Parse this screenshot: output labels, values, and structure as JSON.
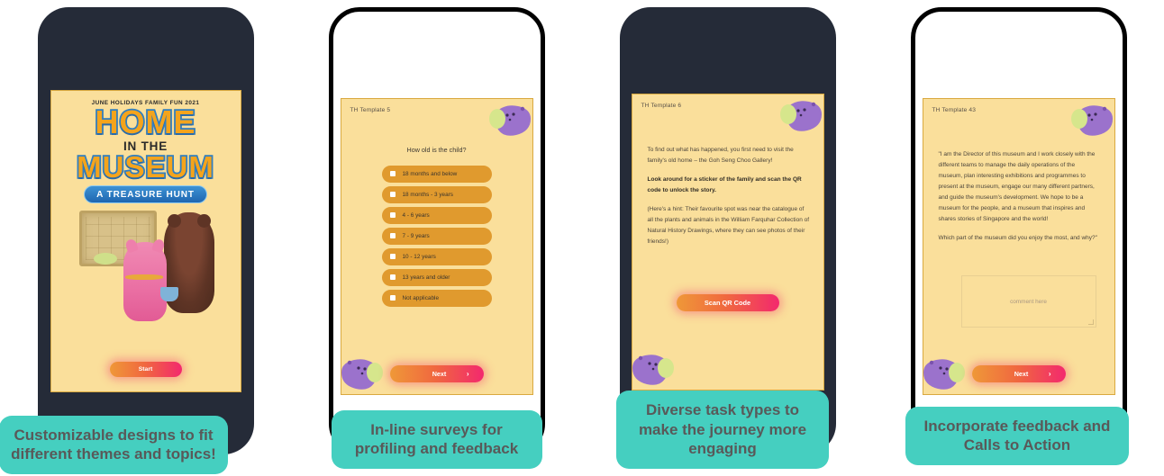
{
  "panels": [
    {
      "frame_style": "solid",
      "caption": "Customizable designs to fit different themes and topics!",
      "cover": {
        "kicker": "JUNE HOLIDAYS FAMILY FUN 2021",
        "title_line1": "HOME",
        "title_line2": "IN THE",
        "title_line3": "MUSEUM",
        "ribbon": "A TREASURE HUNT",
        "cta_label": "Start"
      }
    },
    {
      "frame_style": "outline",
      "caption": "In-line surveys for profiling and feedback",
      "template_label": "TH Template 5",
      "question": "How old is the child?",
      "options": [
        "18 months and below",
        "18 months - 3 years",
        "4 - 6 years",
        "7 - 9 years",
        "10 - 12 years",
        "13 years and older",
        "Not applicable"
      ],
      "cta_label": "Next",
      "cta_chevron": "›"
    },
    {
      "frame_style": "solid",
      "caption": "Diverse task types to make the journey more engaging",
      "template_label": "TH Template 6",
      "paragraphs": [
        {
          "text": "To find out what has happened, you first need to visit the family's old home – the Goh Seng Choo Gallery!",
          "bold": false
        },
        {
          "text": "Look around for a sticker of the family and scan the QR code to unlock the story.",
          "bold": true
        },
        {
          "text": "(Here's a hint: Their favourite spot was near the catalogue of all the plants and animals in the William Farquhar Collection of Natural History Drawings, where they can see photos of their friends!)",
          "bold": false
        }
      ],
      "cta_label": "Scan QR Code"
    },
    {
      "frame_style": "outline",
      "caption": "Incorporate feedback and Calls to Action",
      "template_label": "TH Template 43",
      "paragraphs": [
        {
          "text": "\"I am the Director of this museum and I work closely with the different teams to manage the daily operations of the museum, plan interesting exhibitions and programmes to present at the museum, engage our many different partners, and guide the museum's development. We hope to be a museum for the people, and a museum that inspires and shares stories of Singapore and the world!",
          "bold": false
        },
        {
          "text": "Which part of the museum did you enjoy the most, and why?\"",
          "bold": false
        }
      ],
      "comment_placeholder": "comment here",
      "cta_label": "Next",
      "cta_chevron": "›"
    }
  ],
  "colors": {
    "teal_caption": "#45CFC0",
    "caption_text": "#595959",
    "screen_background": "#FADF9B",
    "screen_border": "#D9A93F",
    "option_pill": "#E09A2E",
    "phone_dark": "#252B38",
    "cta_gradient_start": "#EF9838",
    "cta_gradient_end": "#F3286E",
    "ribbon_blue": "#2F7FC4",
    "title_orange": "#F4A41C"
  }
}
